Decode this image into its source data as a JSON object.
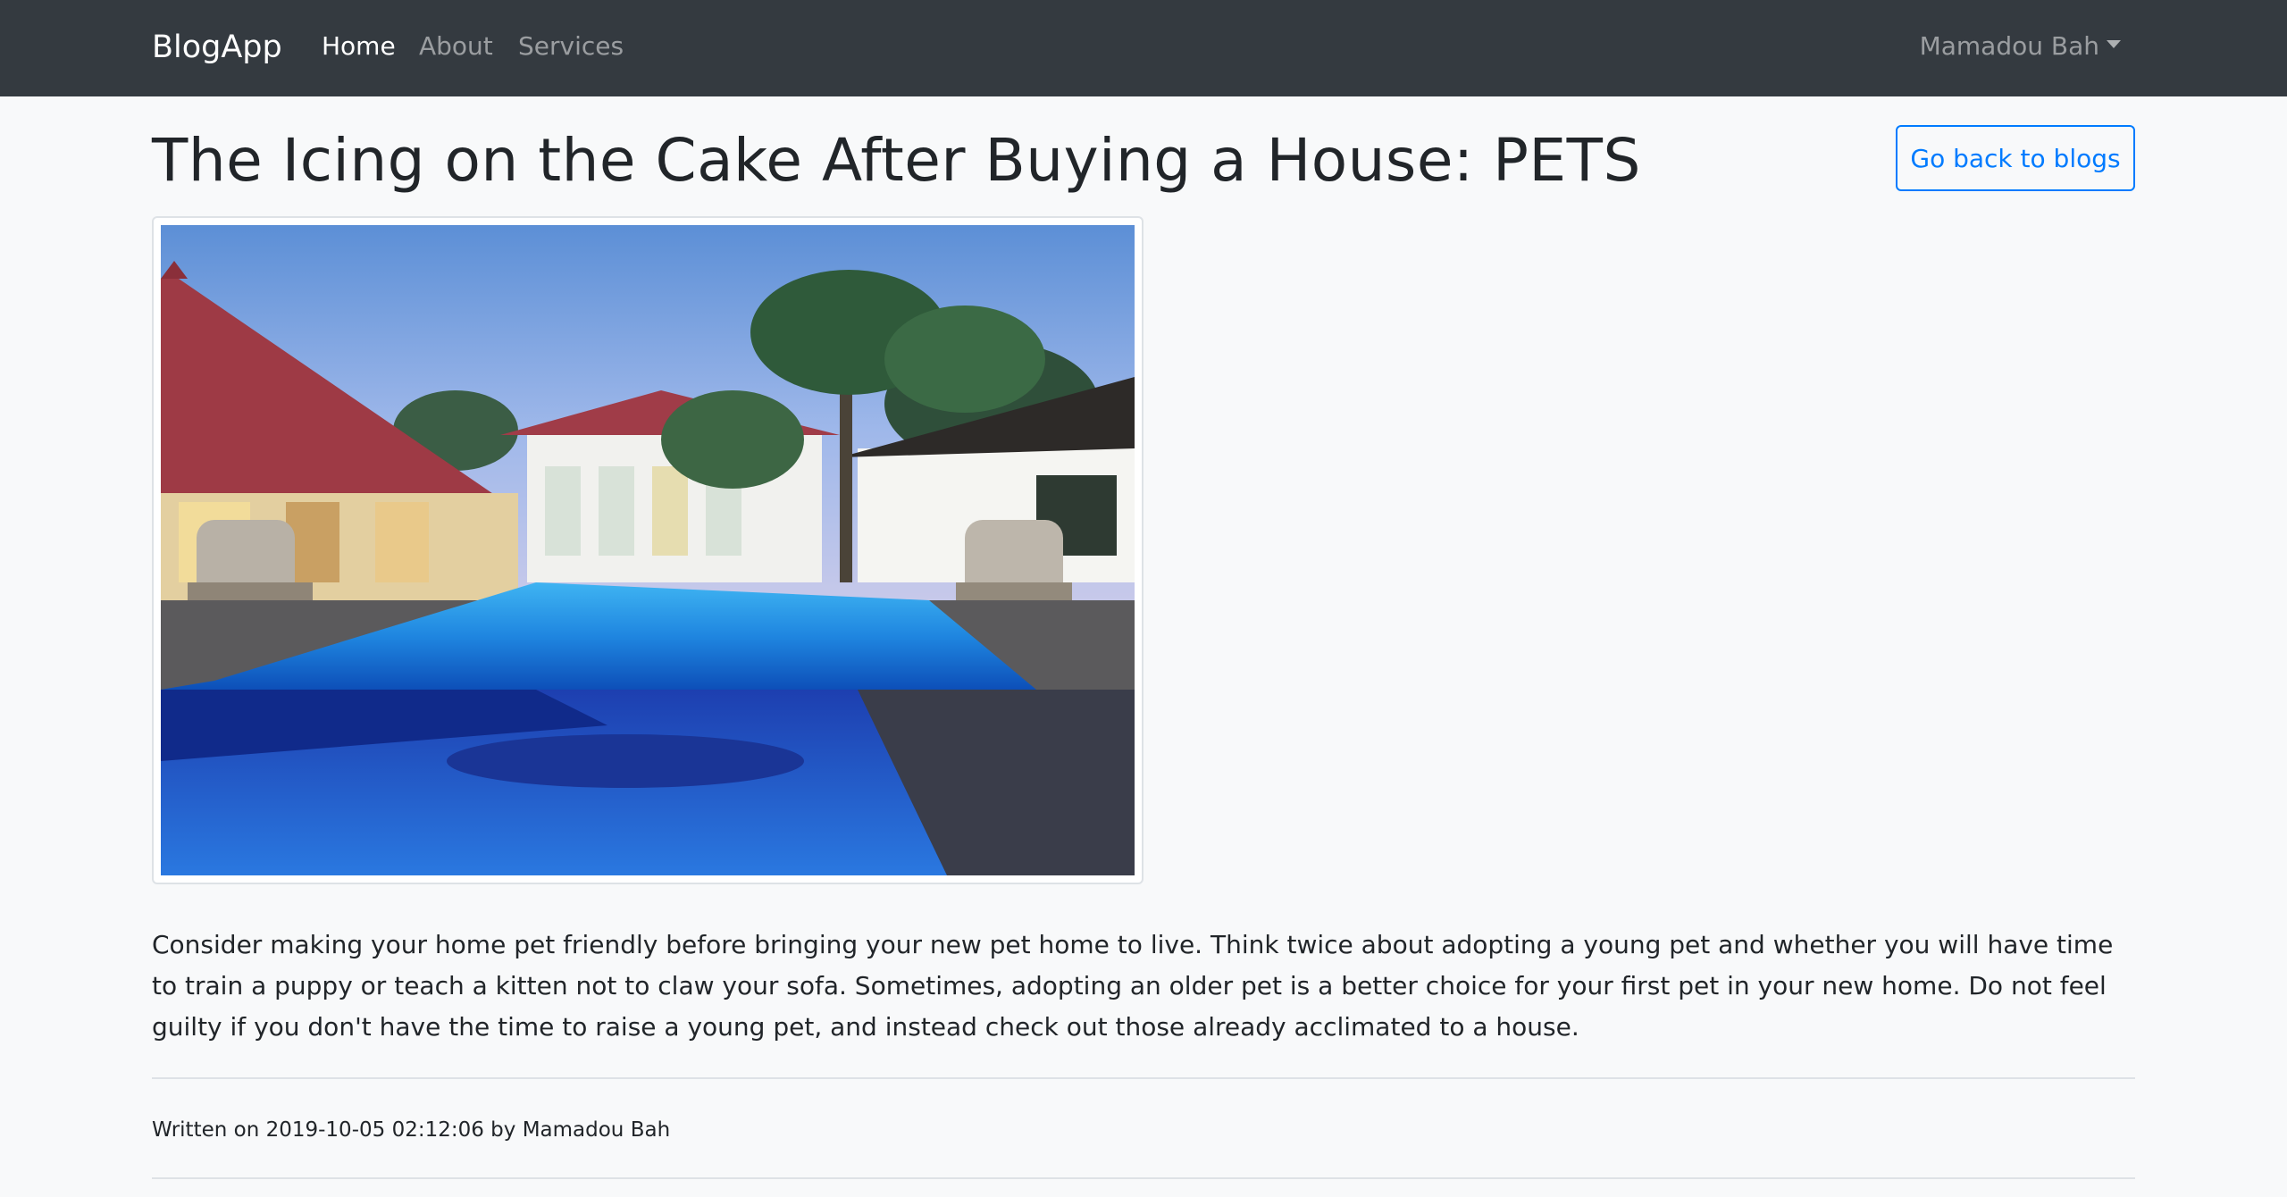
{
  "navbar": {
    "brand": "BlogApp",
    "links": [
      {
        "label": "Home",
        "active": true
      },
      {
        "label": "About",
        "active": false
      },
      {
        "label": "Services",
        "active": false
      }
    ],
    "user": "Mamadou Bah",
    "background": "#343a40"
  },
  "post": {
    "title": "The Icing on the Cake After Buying a House: PETS",
    "back_button": "Go back to blogs",
    "image_icon": "resort-pool-photo",
    "body": "Consider making your home pet friendly before bringing your new pet home to live. Think twice about adopting a young pet and whether you will have time to train a puppy or teach a kitten not to claw your sofa. Sometimes, adopting an older pet is a better choice for your first pet in your new home. Do not feel guilty if you don't have the time to raise a young pet, and instead check out those already acclimated to a house.",
    "meta": "Written on 2019-10-05 02:12:06 by Mamadou Bah"
  },
  "colors": {
    "accent": "#007bff",
    "page_background": "#f8f9fa"
  }
}
